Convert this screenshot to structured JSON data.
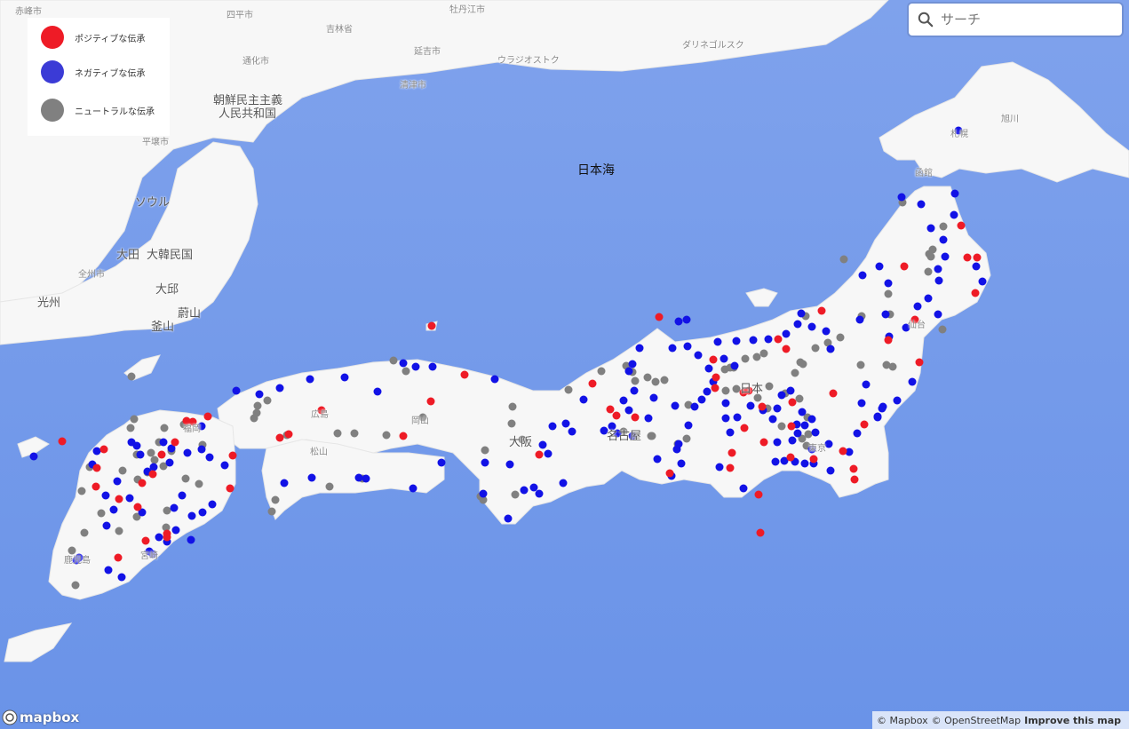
{
  "colors": {
    "water": "#6e96ea",
    "positive": "#ee1b26",
    "negative": "#1212e6",
    "neutral": "#808080"
  },
  "legend": {
    "positive": "ポジティブな伝承",
    "negative": "ネガティブな伝承",
    "neutral": "ニュートラルな伝承"
  },
  "search": {
    "placeholder": "サーチ"
  },
  "labels": {
    "sea": "日本海",
    "korea_north": "朝鮮民主主義",
    "korea_north2": "人民共和国",
    "korea_south": "大韓民国",
    "seoul": "ソウル",
    "daejeon": "大田",
    "jeonju": "全州市",
    "gwangju": "光州",
    "daegu": "大邱",
    "ulsan": "蔚山",
    "busan": "釜山",
    "pyongyang": "平壌市",
    "siping": "四平市",
    "tonghua": "通化市",
    "jilin": "吉林省",
    "yanji": "延吉市",
    "mudanjiang": "牡丹江市",
    "vladivostok": "ウラジオストク",
    "dalnegorsk": "ダリネゴルスク",
    "chongjin": "清津市",
    "chifeng": "赤峰市",
    "asahikawa": "旭川",
    "sapporo": "札幌",
    "hakodate": "函館",
    "nihon": "日本",
    "nagoya": "名古屋",
    "osaka": "大阪",
    "hiroshima": "広島",
    "fukuoka": "福岡",
    "okayama": "岡山",
    "matsuyama": "松山",
    "kagoshima": "鹿児島",
    "miyazaki": "宮崎",
    "sendai": "仙台",
    "tokyo": "東京"
  },
  "attribution": {
    "mapbox": "© Mapbox",
    "osm": "© OpenStreetMap",
    "improve": "Improve this map",
    "logo": "mapbox"
  },
  "points": {
    "positive": [
      [
        1100,
        290
      ],
      [
        1098,
        330
      ],
      [
        1082,
        254
      ],
      [
        1018,
        300
      ],
      [
        1030,
        360
      ],
      [
        1000,
        383
      ],
      [
        1035,
        408
      ],
      [
        925,
        350
      ],
      [
        885,
        393
      ],
      [
        876,
        382
      ],
      [
        803,
        405
      ],
      [
        806,
        425
      ],
      [
        805,
        437
      ],
      [
        837,
        442
      ],
      [
        843,
        440
      ],
      [
        858,
        458
      ],
      [
        838,
        482
      ],
      [
        860,
        498
      ],
      [
        891,
        480
      ],
      [
        916,
        517
      ],
      [
        890,
        515
      ],
      [
        973,
        478
      ],
      [
        961,
        528
      ],
      [
        962,
        540
      ],
      [
        949,
        508
      ],
      [
        854,
        557
      ],
      [
        856,
        600
      ],
      [
        824,
        510
      ],
      [
        822,
        527
      ],
      [
        754,
        533
      ],
      [
        715,
        470
      ],
      [
        694,
        468
      ],
      [
        687,
        461
      ],
      [
        667,
        432
      ],
      [
        607,
        512
      ],
      [
        523,
        422
      ],
      [
        486,
        367
      ],
      [
        485,
        452
      ],
      [
        454,
        491
      ],
      [
        362,
        462
      ],
      [
        325,
        489
      ],
      [
        315,
        493
      ],
      [
        262,
        513
      ],
      [
        259,
        550
      ],
      [
        234,
        469
      ],
      [
        217,
        475
      ],
      [
        210,
        474
      ],
      [
        197,
        498
      ],
      [
        182,
        512
      ],
      [
        172,
        534
      ],
      [
        160,
        544
      ],
      [
        155,
        571
      ],
      [
        134,
        562
      ],
      [
        109,
        527
      ],
      [
        108,
        548
      ],
      [
        117,
        506
      ],
      [
        70,
        497
      ],
      [
        164,
        609
      ],
      [
        188,
        601
      ],
      [
        188,
        605
      ],
      [
        133,
        628
      ],
      [
        742,
        357
      ],
      [
        892,
        453
      ],
      [
        938,
        443
      ],
      [
        1089,
        290
      ]
    ],
    "negative": [
      [
        1075,
        218
      ],
      [
        1037,
        230
      ],
      [
        1015,
        222
      ],
      [
        1074,
        242
      ],
      [
        1048,
        257
      ],
      [
        1062,
        270
      ],
      [
        1064,
        289
      ],
      [
        1056,
        303
      ],
      [
        1057,
        316
      ],
      [
        1045,
        336
      ],
      [
        1106,
        317
      ],
      [
        1099,
        300
      ],
      [
        1056,
        354
      ],
      [
        1033,
        345
      ],
      [
        1020,
        369
      ],
      [
        997,
        354
      ],
      [
        990,
        300
      ],
      [
        1000,
        319
      ],
      [
        1001,
        379
      ],
      [
        971,
        310
      ],
      [
        968,
        360
      ],
      [
        1027,
        430
      ],
      [
        1010,
        451
      ],
      [
        993,
        460
      ],
      [
        988,
        470
      ],
      [
        970,
        454
      ],
      [
        975,
        433
      ],
      [
        935,
        393
      ],
      [
        930,
        373
      ],
      [
        914,
        368
      ],
      [
        902,
        353
      ],
      [
        898,
        365
      ],
      [
        885,
        376
      ],
      [
        865,
        382
      ],
      [
        848,
        383
      ],
      [
        829,
        384
      ],
      [
        808,
        385
      ],
      [
        786,
        400
      ],
      [
        774,
        390
      ],
      [
        773,
        360
      ],
      [
        764,
        362
      ],
      [
        757,
        392
      ],
      [
        720,
        392
      ],
      [
        712,
        410
      ],
      [
        714,
        440
      ],
      [
        708,
        418
      ],
      [
        702,
        451
      ],
      [
        708,
        462
      ],
      [
        736,
        448
      ],
      [
        730,
        471
      ],
      [
        712,
        491
      ],
      [
        695,
        488
      ],
      [
        689,
        480
      ],
      [
        680,
        485
      ],
      [
        657,
        450
      ],
      [
        622,
        480
      ],
      [
        611,
        501
      ],
      [
        617,
        511
      ],
      [
        601,
        549
      ],
      [
        574,
        523
      ],
      [
        546,
        521
      ],
      [
        544,
        556
      ],
      [
        572,
        584
      ],
      [
        634,
        544
      ],
      [
        607,
        556
      ],
      [
        590,
        552
      ],
      [
        497,
        521
      ],
      [
        465,
        550
      ],
      [
        412,
        539
      ],
      [
        404,
        538
      ],
      [
        351,
        538
      ],
      [
        320,
        544
      ],
      [
        315,
        437
      ],
      [
        292,
        444
      ],
      [
        266,
        440
      ],
      [
        349,
        427
      ],
      [
        388,
        425
      ],
      [
        425,
        441
      ],
      [
        454,
        409
      ],
      [
        468,
        413
      ],
      [
        487,
        413
      ],
      [
        557,
        427
      ],
      [
        637,
        477
      ],
      [
        644,
        486
      ],
      [
        740,
        517
      ],
      [
        762,
        506
      ],
      [
        764,
        500
      ],
      [
        767,
        522
      ],
      [
        775,
        479
      ],
      [
        782,
        458
      ],
      [
        790,
        450
      ],
      [
        796,
        441
      ],
      [
        803,
        430
      ],
      [
        798,
        415
      ],
      [
        815,
        404
      ],
      [
        827,
        412
      ],
      [
        817,
        454
      ],
      [
        817,
        471
      ],
      [
        822,
        487
      ],
      [
        830,
        470
      ],
      [
        845,
        457
      ],
      [
        859,
        462
      ],
      [
        870,
        472
      ],
      [
        875,
        460
      ],
      [
        880,
        445
      ],
      [
        890,
        440
      ],
      [
        903,
        464
      ],
      [
        914,
        472
      ],
      [
        918,
        487
      ],
      [
        906,
        479
      ],
      [
        897,
        478
      ],
      [
        898,
        488
      ],
      [
        892,
        496
      ],
      [
        875,
        498
      ],
      [
        873,
        520
      ],
      [
        883,
        519
      ],
      [
        895,
        520
      ],
      [
        906,
        522
      ],
      [
        914,
        506
      ],
      [
        933,
        500
      ],
      [
        935,
        530
      ],
      [
        916,
        522
      ],
      [
        956,
        509
      ],
      [
        965,
        488
      ],
      [
        988,
        469
      ],
      [
        994,
        458
      ],
      [
        810,
        526
      ],
      [
        837,
        550
      ],
      [
        760,
        457
      ],
      [
        756,
        536
      ],
      [
        215,
        608
      ],
      [
        188,
        610
      ],
      [
        179,
        605
      ],
      [
        168,
        621
      ],
      [
        172,
        624
      ],
      [
        198,
        597
      ],
      [
        216,
        581
      ],
      [
        228,
        577
      ],
      [
        239,
        568
      ],
      [
        253,
        524
      ],
      [
        236,
        515
      ],
      [
        227,
        506
      ],
      [
        227,
        480
      ],
      [
        211,
        510
      ],
      [
        191,
        521
      ],
      [
        193,
        505
      ],
      [
        184,
        498
      ],
      [
        173,
        526
      ],
      [
        166,
        531
      ],
      [
        158,
        512
      ],
      [
        154,
        502
      ],
      [
        148,
        498
      ],
      [
        132,
        542
      ],
      [
        119,
        558
      ],
      [
        128,
        574
      ],
      [
        146,
        561
      ],
      [
        160,
        577
      ],
      [
        196,
        572
      ],
      [
        205,
        558
      ],
      [
        137,
        650
      ],
      [
        122,
        642
      ],
      [
        89,
        628
      ],
      [
        86,
        631
      ],
      [
        120,
        592
      ],
      [
        38,
        514
      ],
      [
        104,
        523
      ],
      [
        109,
        508
      ],
      [
        1079,
        147
      ]
    ],
    "neutral": [
      [
        1062,
        255
      ],
      [
        1048,
        289
      ],
      [
        1045,
        306
      ],
      [
        1050,
        281
      ],
      [
        1016,
        228
      ],
      [
        1000,
        331
      ],
      [
        1002,
        354
      ],
      [
        970,
        356
      ],
      [
        946,
        380
      ],
      [
        932,
        386
      ],
      [
        918,
        392
      ],
      [
        904,
        410
      ],
      [
        895,
        420
      ],
      [
        901,
        408
      ],
      [
        907,
        356
      ],
      [
        950,
        292
      ],
      [
        969,
        411
      ],
      [
        998,
        411
      ],
      [
        1005,
        413
      ],
      [
        935,
        393
      ],
      [
        860,
        398
      ],
      [
        852,
        402
      ],
      [
        839,
        404
      ],
      [
        826,
        414
      ],
      [
        816,
        416
      ],
      [
        748,
        428
      ],
      [
        738,
        430
      ],
      [
        729,
        425
      ],
      [
        715,
        429
      ],
      [
        677,
        418
      ],
      [
        705,
        412
      ],
      [
        712,
        419
      ],
      [
        817,
        440
      ],
      [
        829,
        438
      ],
      [
        853,
        448
      ],
      [
        866,
        435
      ],
      [
        864,
        460
      ],
      [
        884,
        443
      ],
      [
        900,
        449
      ],
      [
        909,
        470
      ],
      [
        910,
        489
      ],
      [
        903,
        494
      ],
      [
        880,
        480
      ],
      [
        908,
        502
      ],
      [
        775,
        456
      ],
      [
        773,
        494
      ],
      [
        763,
        500
      ],
      [
        734,
        491
      ],
      [
        702,
        486
      ],
      [
        733,
        491
      ],
      [
        822,
        414
      ],
      [
        1061,
        371
      ],
      [
        1046,
        286
      ],
      [
        577,
        458
      ],
      [
        576,
        477
      ],
      [
        588,
        495
      ],
      [
        546,
        507
      ],
      [
        541,
        559
      ],
      [
        580,
        557
      ],
      [
        544,
        563
      ],
      [
        640,
        439
      ],
      [
        443,
        406
      ],
      [
        457,
        418
      ],
      [
        435,
        490
      ],
      [
        476,
        470
      ],
      [
        380,
        488
      ],
      [
        399,
        488
      ],
      [
        371,
        548
      ],
      [
        408,
        539
      ],
      [
        310,
        563
      ],
      [
        306,
        576
      ],
      [
        290,
        457
      ],
      [
        289,
        465
      ],
      [
        286,
        471
      ],
      [
        323,
        490
      ],
      [
        301,
        451
      ],
      [
        148,
        424
      ],
      [
        151,
        472
      ],
      [
        147,
        482
      ],
      [
        154,
        512
      ],
      [
        185,
        482
      ],
      [
        207,
        478
      ],
      [
        179,
        498
      ],
      [
        170,
        510
      ],
      [
        193,
        508
      ],
      [
        209,
        539
      ],
      [
        184,
        525
      ],
      [
        166,
        532
      ],
      [
        155,
        540
      ],
      [
        138,
        530
      ],
      [
        101,
        526
      ],
      [
        92,
        553
      ],
      [
        114,
        578
      ],
      [
        134,
        598
      ],
      [
        154,
        582
      ],
      [
        95,
        600
      ],
      [
        81,
        620
      ],
      [
        85,
        659
      ],
      [
        174,
        518
      ],
      [
        228,
        501
      ],
      [
        224,
        545
      ],
      [
        188,
        575
      ],
      [
        187,
        594
      ]
    ]
  }
}
